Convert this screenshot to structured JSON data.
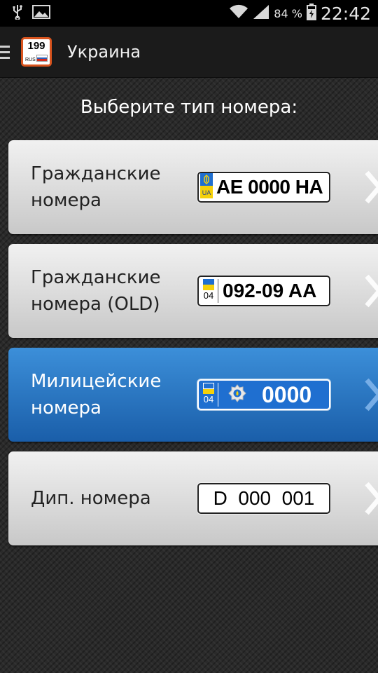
{
  "status_bar": {
    "battery": "84 %",
    "time": "22:42",
    "icons": [
      "usb-icon",
      "image-icon",
      "wifi-icon",
      "signal-icon",
      "battery-icon"
    ]
  },
  "action_bar": {
    "title": "Украина",
    "logo": {
      "number": "199",
      "region": "RUS"
    }
  },
  "heading": "Выберите тип номера:",
  "plate_types": [
    {
      "label": "Гражданские номера",
      "plate_text": "AE 0000 HA",
      "plate_flag_code": "UA",
      "selected": false
    },
    {
      "label": "Гражданские номера (OLD)",
      "plate_text": "092-09 AA",
      "plate_region_code": "04",
      "selected": false
    },
    {
      "label": "Милицейские номера",
      "plate_text": "0000",
      "plate_region_code": "04",
      "selected": true
    },
    {
      "label": "Дип. номера",
      "plate_text": "D  000  001",
      "selected": false
    }
  ],
  "colors": {
    "accent_selected": "#2a7bd0",
    "logo_border": "#d9541e",
    "ua_blue": "#1f6fd0",
    "ua_yellow": "#f5d10a"
  }
}
